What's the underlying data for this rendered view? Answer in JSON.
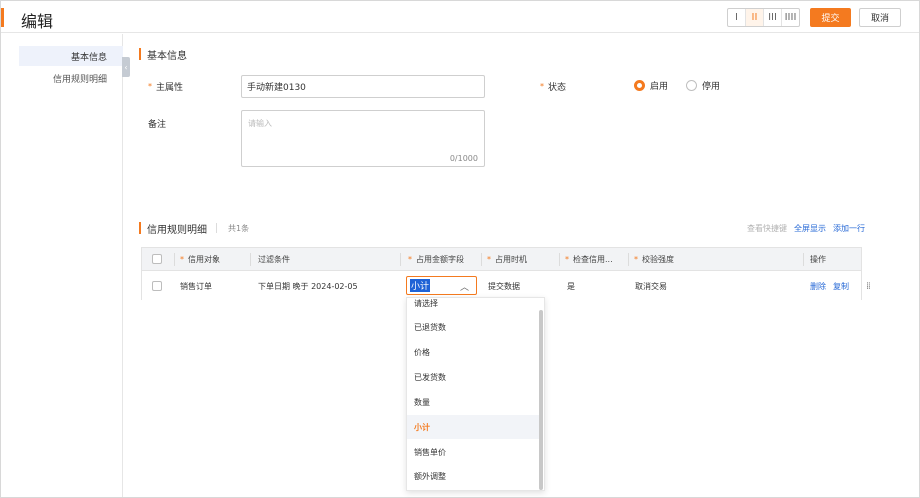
{
  "header": {
    "title": "编辑",
    "layout_options": [
      "I",
      "II",
      "III",
      "IIII"
    ],
    "active_layout_index": 1,
    "submit_label": "提交",
    "cancel_label": "取消"
  },
  "sidebar": {
    "items": [
      {
        "label": "基本信息",
        "active": true
      },
      {
        "label": "信用规则明细",
        "active": false
      }
    ],
    "collapse_glyph": "‹"
  },
  "basic": {
    "section_title": "基本信息",
    "main_attr_label": "主属性",
    "main_attr_value": "手动新建0130",
    "status_label": "状态",
    "status_options": [
      {
        "label": "启用",
        "checked": true
      },
      {
        "label": "停用",
        "checked": false
      }
    ],
    "remark_label": "备注",
    "remark_placeholder": "请输入",
    "remark_count": "0/1000"
  },
  "detail": {
    "section_title": "信用规则明细",
    "count_text": "共1条",
    "tools": {
      "shortcut": "查看快捷键",
      "fullscreen": "全屏显示",
      "add_row": "添加一行"
    },
    "columns": [
      "信用对象",
      "过滤条件",
      "占用金额字段",
      "占用时机",
      "检查信用...",
      "校验强度",
      "操作"
    ],
    "required_columns": [
      true,
      false,
      true,
      true,
      true,
      true,
      false
    ],
    "rows": [
      {
        "credit_object": "销售订单",
        "filter": "下单日期 晚于 2024-02-05",
        "amount_field": "小计",
        "timing": "提交数据",
        "check_credit": "是",
        "strength": "取消交易",
        "actions": [
          "删除",
          "复制"
        ]
      }
    ]
  },
  "dropdown": {
    "options": [
      "请选择",
      "已退货数",
      "价格",
      "已发货数",
      "数量",
      "小计",
      "销售单价",
      "额外调整"
    ],
    "selected": "小计"
  },
  "colors": {
    "accent": "#f47a1f",
    "link": "#2668d6",
    "selection": "#1f63d6"
  }
}
